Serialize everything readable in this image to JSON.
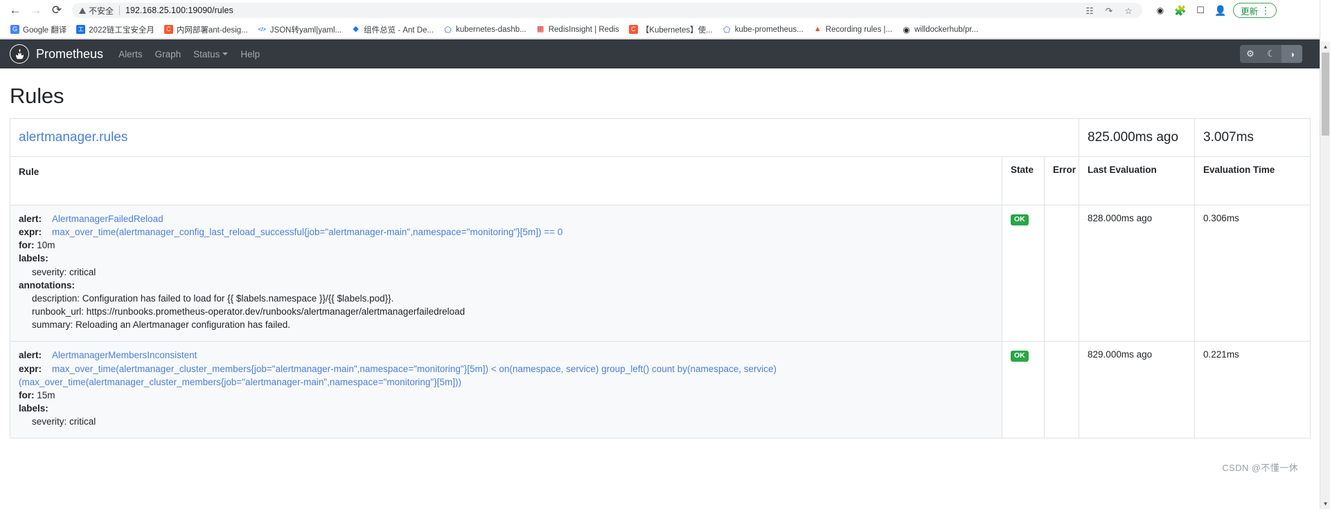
{
  "browser": {
    "nav": {
      "back_icon": "back-arrow-icon",
      "forward_icon": "forward-arrow-icon",
      "reload_icon": "reload-icon"
    },
    "omnibox": {
      "security_label": "不安全",
      "url": "192.168.25.100:19090/rules",
      "translate_icon": "translate-icon",
      "share_icon": "share-icon",
      "bookmark_icon": "star-icon"
    },
    "extensions": [
      {
        "name": "dark-reader-extension-icon",
        "glyph": "●●"
      },
      {
        "name": "extensions-puzzle-icon",
        "glyph": "✦"
      },
      {
        "name": "side-panel-icon",
        "glyph": "▣"
      },
      {
        "name": "profile-avatar-icon",
        "glyph": "●"
      }
    ],
    "update_button": {
      "label": "更新",
      "menu_icon": "kebab-menu-icon",
      "color": "#1e8e3e"
    },
    "bookmarks": [
      {
        "label": "Google 翻译",
        "icon": "google-translate-icon",
        "color": "#4285f4",
        "glyph": "G"
      },
      {
        "label": "2022链工宝安全月",
        "icon": "site-icon",
        "color": "#1a73e8",
        "glyph": "工"
      },
      {
        "label": "内网部署ant-desig...",
        "icon": "csdn-icon",
        "color": "#fc5531",
        "glyph": "C"
      },
      {
        "label": "JSON转yaml|yaml...",
        "icon": "code-icon",
        "color": "#2d8cf0",
        "glyph": "</>"
      },
      {
        "label": "组件总览 - Ant De...",
        "icon": "ant-design-icon",
        "color": "#1677ff",
        "glyph": "◆"
      },
      {
        "label": "kubernetes-dashb...",
        "icon": "kubernetes-icon",
        "color": "#326ce5",
        "glyph": "⎈"
      },
      {
        "label": "RedisInsight | Redis",
        "icon": "redis-icon",
        "color": "#d82c20",
        "glyph": "▤"
      },
      {
        "label": "【Kubernetes】使...",
        "icon": "csdn-icon",
        "color": "#fc5531",
        "glyph": "C"
      },
      {
        "label": "kube-prometheus...",
        "icon": "kubernetes-icon",
        "color": "#326ce5",
        "glyph": "⎈"
      },
      {
        "label": "Recording rules |...",
        "icon": "prometheus-icon",
        "color": "#e6522c",
        "glyph": "▲"
      },
      {
        "label": "willdockerhub/pr...",
        "icon": "github-icon",
        "color": "#24292f",
        "glyph": "◉"
      }
    ]
  },
  "app": {
    "brand": "Prometheus",
    "logo_icon": "prometheus-torch-icon",
    "nav_items": [
      {
        "label": "Alerts",
        "name": "nav-alerts",
        "dropdown": false
      },
      {
        "label": "Graph",
        "name": "nav-graph",
        "dropdown": false
      },
      {
        "label": "Status",
        "name": "nav-status",
        "dropdown": true
      },
      {
        "label": "Help",
        "name": "nav-help",
        "dropdown": false
      }
    ],
    "theme_buttons": [
      {
        "name": "theme-light-button",
        "icon": "gear-sun-icon",
        "glyph": "⚙",
        "active": false
      },
      {
        "name": "theme-dark-button",
        "icon": "moon-icon",
        "glyph": "☾",
        "active": false
      },
      {
        "name": "theme-auto-button",
        "icon": "half-circle-contrast-icon",
        "glyph": "◑",
        "active": true
      }
    ]
  },
  "page": {
    "title": "Rules",
    "watermark": "CSDN @不懂一休"
  },
  "group": {
    "name": "alertmanager.rules",
    "last_evaluation": "825.000ms ago",
    "evaluation_time": "3.007ms"
  },
  "table": {
    "headers": {
      "rule": "Rule",
      "state": "State",
      "error": "Error",
      "last_evaluation": "Last Evaluation",
      "evaluation_time": "Evaluation Time"
    },
    "rows": [
      {
        "alert_key": "alert:",
        "alert_name": "AlertmanagerFailedReload",
        "expr_key": "expr:",
        "expr": "max_over_time(alertmanager_config_last_reload_successful{job=\"alertmanager-main\",namespace=\"monitoring\"}[5m]) == 0",
        "for_key": "for:",
        "for_value": "10m",
        "labels_key": "labels:",
        "labels": [
          "severity: critical"
        ],
        "annotations_key": "annotations:",
        "annotations": [
          "description: Configuration has failed to load for {{ $labels.namespace }}/{{ $labels.pod}}.",
          "runbook_url: https://runbooks.prometheus-operator.dev/runbooks/alertmanager/alertmanagerfailedreload",
          "summary: Reloading an Alertmanager configuration has failed."
        ],
        "state": "OK",
        "error": "",
        "last_evaluation": "828.000ms ago",
        "evaluation_time": "0.306ms"
      },
      {
        "alert_key": "alert:",
        "alert_name": "AlertmanagerMembersInconsistent",
        "expr_key": "expr:",
        "expr": "max_over_time(alertmanager_cluster_members{job=\"alertmanager-main\",namespace=\"monitoring\"}[5m]) < on(namespace, service) group_left() count by(namespace, service) (max_over_time(alertmanager_cluster_members{job=\"alertmanager-main\",namespace=\"monitoring\"}[5m]))",
        "for_key": "for:",
        "for_value": "15m",
        "labels_key": "labels:",
        "labels": [
          "severity: critical"
        ],
        "annotations_key": "annotations:",
        "annotations": [],
        "state": "OK",
        "error": "",
        "last_evaluation": "829.000ms ago",
        "evaluation_time": "0.221ms"
      }
    ]
  }
}
